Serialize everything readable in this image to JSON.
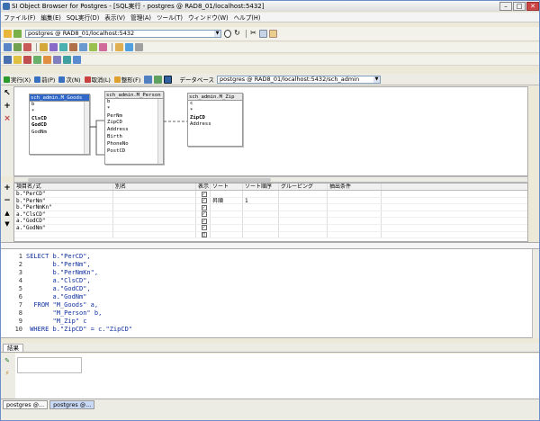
{
  "window": {
    "title": "SI Object Browser for Postgres - [SQL実行 - postgres @ RAD8_01/localhost:5432]"
  },
  "menu": [
    "ファイル(F)",
    "編集(E)",
    "SQL実行(D)",
    "表示(V)",
    "管理(A)",
    "ツール(T)",
    "ウィンドウ(W)",
    "ヘルプ(H)"
  ],
  "connection": {
    "value": "postgres @ RAD8_01/localhost:5432"
  },
  "query_toolbar": {
    "execute": "実行(X)",
    "prev": "前(P)",
    "next": "次(N)",
    "cancel": "取消(L)",
    "format": "整形(F)",
    "database_label": "データベース",
    "database_value": "postgres @ RAD8_01/localhost:5432/sch_admin"
  },
  "tables": [
    {
      "name": "sch_admin.M_Goods",
      "columns": [
        "b",
        "*",
        "ClsCD",
        "GodCD",
        "GodNm"
      ],
      "bold": [
        2,
        3
      ],
      "selected": true
    },
    {
      "name": "sch_admin.M_Person",
      "columns": [
        "b",
        "*",
        "PerNm",
        "ZipCD",
        "Address",
        "Birth",
        "PhoneNo",
        "PostCD"
      ],
      "bold": [],
      "selected": false
    },
    {
      "name": "sch_admin.M_Zip",
      "columns": [
        "c",
        "*",
        "ZipCD",
        "Address"
      ],
      "bold": [
        2
      ],
      "selected": false
    }
  ],
  "grid": {
    "headers": [
      "項目名/式",
      "別名",
      "表示",
      "ソート",
      "ソート順序",
      "グルーピング",
      "抽出条件"
    ],
    "rows": [
      {
        "expr": "b.\"PerCD\"",
        "alias": "",
        "show": "✓",
        "sort": "",
        "order": ""
      },
      {
        "expr": "b.\"PerNm\"",
        "alias": "",
        "show": "✓",
        "sort": "昇順",
        "order": "1"
      },
      {
        "expr": "b.\"PerNmKn\"",
        "alias": "",
        "show": "✓",
        "sort": "",
        "order": ""
      },
      {
        "expr": "a.\"ClsCD\"",
        "alias": "",
        "show": "✓",
        "sort": "",
        "order": ""
      },
      {
        "expr": "a.\"GodCD\"",
        "alias": "",
        "show": "✓",
        "sort": "",
        "order": ""
      },
      {
        "expr": "a.\"GodNm\"",
        "alias": "",
        "show": "✓",
        "sort": "",
        "order": ""
      },
      {
        "expr": "",
        "alias": "",
        "show": "□",
        "sort": "",
        "order": ""
      }
    ]
  },
  "editor": {
    "lines": [
      {
        "n": "1",
        "t": "SELECT b.\"PerCD\","
      },
      {
        "n": "2",
        "t": "       b.\"PerNm\","
      },
      {
        "n": "3",
        "t": "       b.\"PerNmKn\","
      },
      {
        "n": "4",
        "t": "       a.\"ClsCD\","
      },
      {
        "n": "5",
        "t": "       a.\"GodCD\","
      },
      {
        "n": "6",
        "t": "       a.\"GodNm\""
      },
      {
        "n": "7",
        "t": "  FROM \"M_Goods\" a,"
      },
      {
        "n": "8",
        "t": "       \"M_Person\" b,"
      },
      {
        "n": "9",
        "t": "       \"M_Zip\" c"
      },
      {
        "n": "10",
        "t": " WHERE b.\"ZipCD\" = c.\"ZipCD\""
      }
    ]
  },
  "results_tab": "結果",
  "status_tabs": [
    "postgres @...",
    "postgres @..."
  ]
}
